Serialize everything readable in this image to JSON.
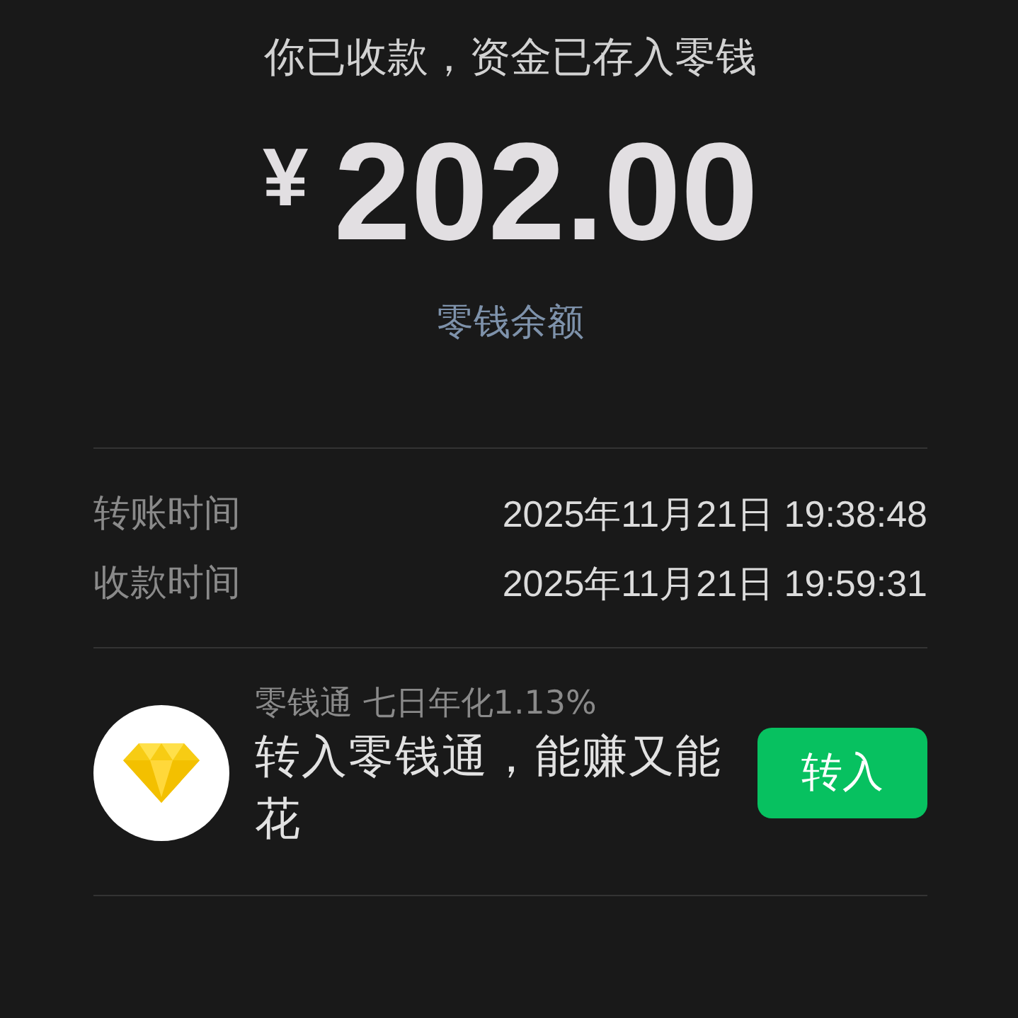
{
  "title": "你已收款，资金已存入零钱",
  "amount": {
    "currency": "¥",
    "value": "202.00"
  },
  "balance_link": "零钱余额",
  "details": [
    {
      "label": "转账时间",
      "value": "2025年11月21日 19:38:48"
    },
    {
      "label": "收款时间",
      "value": "2025年11月21日 19:59:31"
    }
  ],
  "promo": {
    "subtitle": "零钱通 七日年化1.13%",
    "text": "转入零钱通，能赚又能花",
    "button": "转入"
  }
}
